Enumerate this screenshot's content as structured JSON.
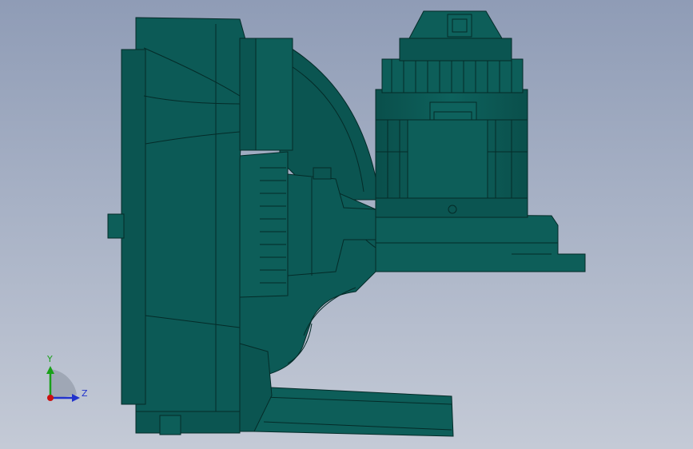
{
  "viewport": {
    "background_top": "#8f9cb6",
    "background_bottom": "#c4cad6",
    "model_color": "#0c5a56",
    "edge_color": "#042b28"
  },
  "triad": {
    "y_label": "Y",
    "z_label": "Z",
    "y_color": "#19a019",
    "z_color": "#2233cc",
    "x_color": "#cc1111"
  }
}
